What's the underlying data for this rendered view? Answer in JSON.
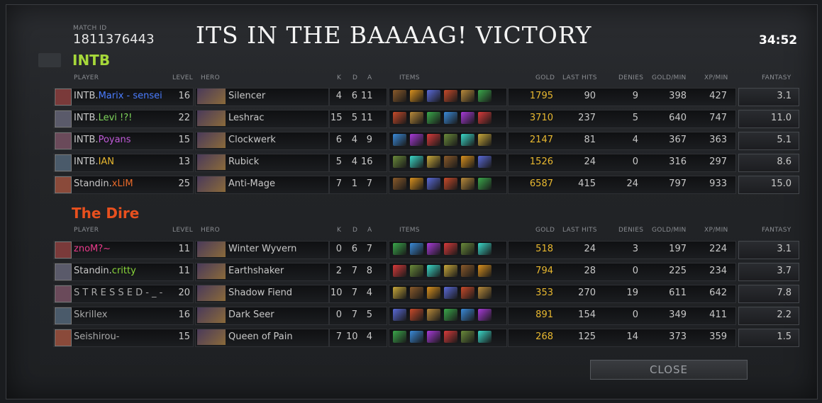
{
  "match": {
    "id_label": "MATCH ID",
    "id": "1811376443"
  },
  "title": "ITS IN THE BAAAAG! VICTORY",
  "duration": "34:52",
  "headers": {
    "player": "PLAYER",
    "level": "LEVEL",
    "hero": "HERO",
    "k": "K",
    "d": "D",
    "a": "A",
    "items": "ITEMS",
    "gold": "GOLD",
    "last_hits": "LAST HITS",
    "denies": "DENIES",
    "gold_min": "GOLD/MIN",
    "xp_min": "XP/MIN",
    "fantasy": "FANTASY"
  },
  "radiant": {
    "name": "INTB",
    "color": "#a6d83a",
    "players": [
      {
        "prefix": "INTB.",
        "name": "Marix - sensei",
        "name_color": "#4a7cff",
        "level": "16",
        "hero": "Silencer",
        "k": "4",
        "d": "6",
        "a": "11",
        "gold": "1795",
        "lh": "90",
        "dn": "9",
        "gpm": "398",
        "xpm": "427",
        "fantasy": "3.1"
      },
      {
        "prefix": "INTB.",
        "name": "Levi !?!",
        "name_color": "#7ed45a",
        "level": "22",
        "hero": "Leshrac",
        "k": "15",
        "d": "5",
        "a": "11",
        "gold": "3710",
        "lh": "237",
        "dn": "5",
        "gpm": "640",
        "xpm": "747",
        "fantasy": "11.0"
      },
      {
        "prefix": "INTB.",
        "name": "Poyans",
        "name_color": "#c05ad8",
        "level": "15",
        "hero": "Clockwerk",
        "k": "6",
        "d": "4",
        "a": "9",
        "gold": "2147",
        "lh": "81",
        "dn": "4",
        "gpm": "367",
        "xpm": "363",
        "fantasy": "5.1"
      },
      {
        "prefix": "INTB.",
        "name": "IAN",
        "name_color": "#e8b830",
        "level": "13",
        "hero": "Rubick",
        "k": "5",
        "d": "4",
        "a": "16",
        "gold": "1526",
        "lh": "24",
        "dn": "0",
        "gpm": "316",
        "xpm": "297",
        "fantasy": "8.6"
      },
      {
        "prefix": "Standin.",
        "name": "xLiM",
        "name_color": "#e86a2a",
        "level": "25",
        "hero": "Anti-Mage",
        "k": "7",
        "d": "1",
        "a": "7",
        "gold": "6587",
        "lh": "415",
        "dn": "24",
        "gpm": "797",
        "xpm": "933",
        "fantasy": "15.0"
      }
    ]
  },
  "dire": {
    "name": "The Dire",
    "color": "#e8501e",
    "players": [
      {
        "prefix": "",
        "name": "znoM?~",
        "name_color": "#e83a8a",
        "level": "11",
        "hero": "Winter Wyvern",
        "k": "0",
        "d": "6",
        "a": "7",
        "gold": "518",
        "lh": "24",
        "dn": "3",
        "gpm": "197",
        "xpm": "224",
        "fantasy": "3.1"
      },
      {
        "prefix": "Standin.",
        "name": "critty",
        "name_color": "#8ad83a",
        "level": "11",
        "hero": "Earthshaker",
        "k": "2",
        "d": "7",
        "a": "8",
        "gold": "794",
        "lh": "28",
        "dn": "0",
        "gpm": "225",
        "xpm": "234",
        "fantasy": "3.7"
      },
      {
        "prefix": "",
        "name": "S T R E S S E D - _ -",
        "name_color": "#a8a8a8",
        "level": "20",
        "hero": "Shadow Fiend",
        "k": "10",
        "d": "7",
        "a": "4",
        "gold": "353",
        "lh": "270",
        "dn": "19",
        "gpm": "611",
        "xpm": "642",
        "fantasy": "7.8"
      },
      {
        "prefix": "",
        "name": "Skrillex",
        "name_color": "#a8a8a8",
        "level": "16",
        "hero": "Dark Seer",
        "k": "0",
        "d": "7",
        "a": "5",
        "gold": "891",
        "lh": "154",
        "dn": "0",
        "gpm": "349",
        "xpm": "411",
        "fantasy": "2.2"
      },
      {
        "prefix": "",
        "name": "Seishirou-",
        "name_color": "#a8a8a8",
        "level": "15",
        "hero": "Queen of Pain",
        "k": "7",
        "d": "10",
        "a": "4",
        "gold": "268",
        "lh": "125",
        "dn": "14",
        "gpm": "373",
        "xpm": "359",
        "fantasy": "1.5"
      }
    ]
  },
  "close_label": "CLOSE",
  "colors": {
    "gold": "#e8b830",
    "background": "#222427"
  }
}
